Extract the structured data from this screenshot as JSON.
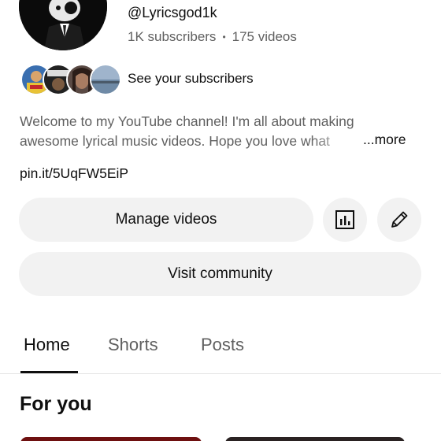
{
  "channel": {
    "handle": "@Lyricsgod1k",
    "subscribers": "1K subscribers",
    "separator": "•",
    "videos": "175 videos",
    "avatar_icon": "channel-avatar"
  },
  "subscribers_preview": {
    "label": "See your subscribers",
    "avatars": [
      "subscriber-avatar-1",
      "subscriber-avatar-2",
      "subscriber-avatar-3",
      "subscriber-avatar-4"
    ]
  },
  "description": {
    "line1": "Welcome to my YouTube channel! I'm all about making",
    "line2": "awesome lyrical music videos. Hope you love what",
    "more": "...more",
    "link": "pin.it/5UqFW5EiP"
  },
  "actions": {
    "manage_videos": "Manage videos",
    "stats_icon": "analytics-icon",
    "edit_icon": "pencil-icon",
    "visit_community": "Visit community"
  },
  "tabs": [
    {
      "label": "Home",
      "active": true
    },
    {
      "label": "Shorts",
      "active": false
    },
    {
      "label": "Posts",
      "active": false
    }
  ],
  "section": {
    "title": "For you"
  }
}
